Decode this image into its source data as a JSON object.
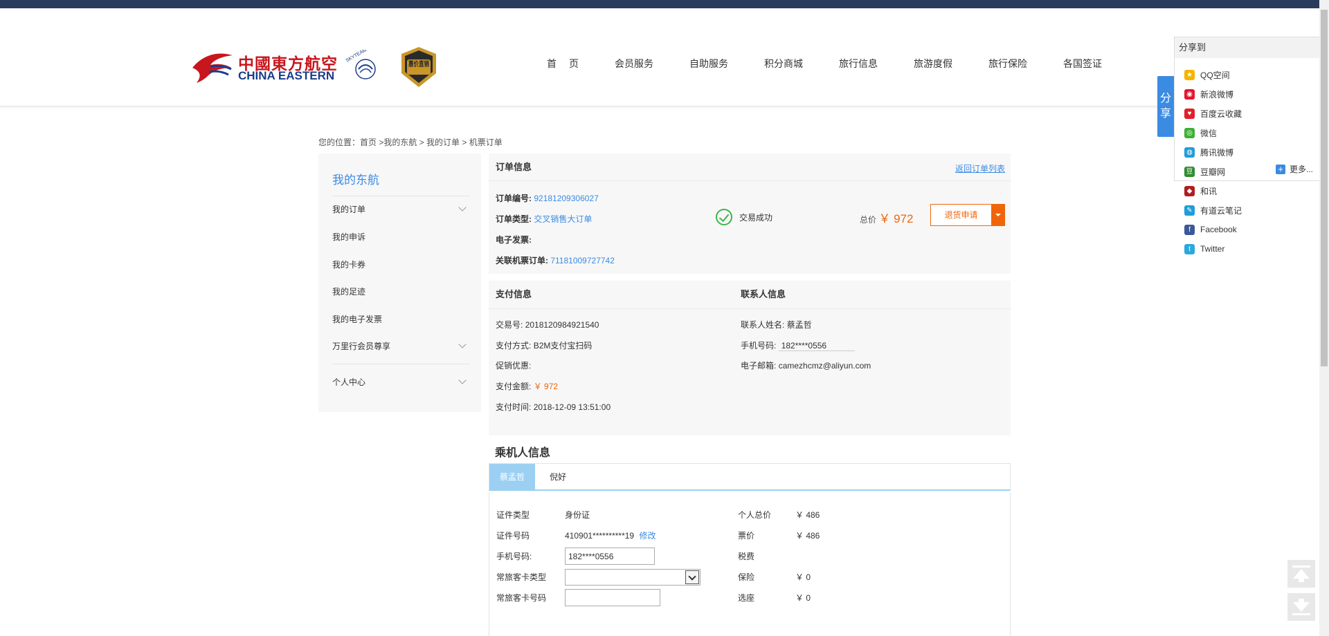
{
  "brand": {
    "name_cn": "中國東方航空",
    "name_en": "CHINA EASTERN",
    "alliance": "SKYTEAM",
    "badge": "惠价直销",
    "colors": {
      "red": "#c8161d",
      "blue": "#1a3c8a",
      "gold": "#c9962a"
    }
  },
  "nav": [
    "首页",
    "会员服务",
    "自助服务",
    "积分商城",
    "旅行信息",
    "旅游度假",
    "旅行保险",
    "各国签证"
  ],
  "share": {
    "tab_label": "分享",
    "title": "分享到",
    "items": [
      {
        "label": "QQ空间",
        "icon": "qzone-icon",
        "color": "#f5b400",
        "glyph": "★"
      },
      {
        "label": "新浪微博",
        "icon": "weibo-icon",
        "color": "#e6162d",
        "glyph": "◉"
      },
      {
        "label": "百度云收藏",
        "icon": "baidu-heart-icon",
        "color": "#e0202a",
        "glyph": "♥"
      },
      {
        "label": "微信",
        "icon": "wechat-icon",
        "color": "#3cb034",
        "glyph": "◎"
      },
      {
        "label": "腾讯微博",
        "icon": "tencent-weibo-icon",
        "color": "#1e9ed8",
        "glyph": "◍"
      },
      {
        "label": "豆瓣网",
        "icon": "douban-icon",
        "color": "#2f8a2f",
        "glyph": "豆"
      },
      {
        "label": "和讯",
        "icon": "hexun-icon",
        "color": "#b01d22",
        "glyph": "◆"
      },
      {
        "label": "有道云笔记",
        "icon": "youdao-icon",
        "color": "#1e9ed8",
        "glyph": "✎"
      },
      {
        "label": "Facebook",
        "icon": "facebook-icon",
        "color": "#3b5998",
        "glyph": "f"
      },
      {
        "label": "Twitter",
        "icon": "twitter-icon",
        "color": "#2aa9e0",
        "glyph": "t"
      }
    ],
    "more": "更多..."
  },
  "breadcrumb": "您的位置：首页 >我的东航 > 我的订单 > 机票订单",
  "sidebar": {
    "title": "我的东航",
    "items": [
      "我的订单",
      "我的申诉",
      "我的卡券",
      "我的足迹",
      "我的电子发票",
      "万里行会员尊享",
      "个人中心"
    ]
  },
  "order": {
    "title": "订单信息",
    "back_link": "返回订单列表",
    "number_label": "订单编号:",
    "number": "92181209306027",
    "type_label": "订单类型:",
    "type": "交叉销售大订单",
    "invoice_label": "电子发票:",
    "linked_label": "关联机票订单:",
    "linked": "71181009727742",
    "status": "交易成功",
    "total_label": "总价",
    "total": "￥ 972",
    "refund_button": "退货申请"
  },
  "payment": {
    "title": "支付信息",
    "trade_no_label": "交易号:",
    "trade_no": "2018120984921540",
    "method_label": "支付方式:",
    "method": "B2M支付宝扫码",
    "promo_label": "促销优惠:",
    "amount_label": "支付金额:",
    "amount": "￥ 972",
    "time_label": "支付时间:",
    "time": "2018-12-09 13:51:00"
  },
  "contact": {
    "title": "联系人信息",
    "name_label": "联系人姓名:",
    "name": "蔡孟哲",
    "phone_label": "手机号码:",
    "phone": "182****0556",
    "email_label": "电子邮箱:",
    "email": "camezhcmz@aliyun.com"
  },
  "passenger": {
    "section_title": "乘机人信息",
    "tabs": [
      "蔡孟哲",
      "倪好"
    ],
    "id_type_label": "证件类型",
    "id_type": "身份证",
    "id_no_label": "证件号码",
    "id_no": "410901**********19",
    "edit": "修改",
    "phone_label": "手机号码:",
    "phone": "182****0556",
    "ff_type_label": "常旅客卡类型",
    "ff_no_label": "常旅客卡号码",
    "personal_total_label": "个人总价",
    "personal_total": "￥ 486",
    "fare_label": "票价",
    "fare": "￥ 486",
    "tax_label": "税费",
    "insurance_label": "保险",
    "insurance": "￥ 0",
    "seat_label": "选座",
    "seat": "￥ 0"
  }
}
